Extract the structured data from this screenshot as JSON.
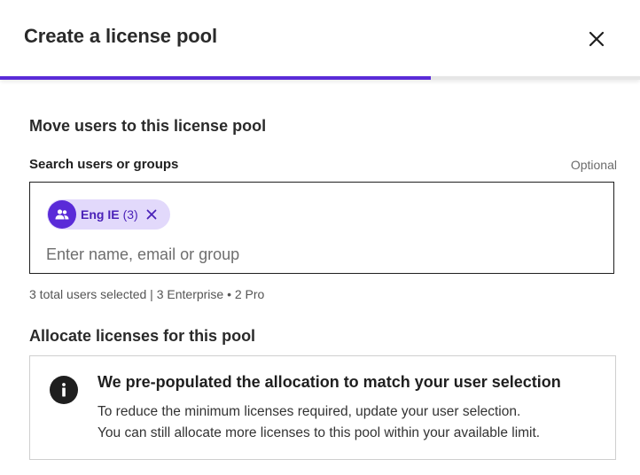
{
  "dialog": {
    "title": "Create a license pool",
    "progress_fraction": 0.673
  },
  "move_users": {
    "heading": "Move users to this license pool",
    "search_label": "Search users or groups",
    "optional_label": "Optional",
    "chips": [
      {
        "name": "Eng IE",
        "count": "(3)",
        "icon": "group-icon"
      }
    ],
    "search_placeholder": "Enter name, email or group",
    "search_value": "",
    "helper_text": "3 total users selected | 3 Enterprise • 2 Pro"
  },
  "allocate": {
    "heading": "Allocate licenses for this pool",
    "info_icon": "info-icon",
    "info_title": "We pre-populated the allocation to match your user selection",
    "info_lines": [
      "To reduce the minimum licenses required, update your user selection.",
      "You can still allocate more licenses to this pool within your available limit."
    ]
  },
  "colors": {
    "accent": "#5a2bd8",
    "chip_background": "#e2d9fb",
    "chip_text": "#4a22b8"
  }
}
